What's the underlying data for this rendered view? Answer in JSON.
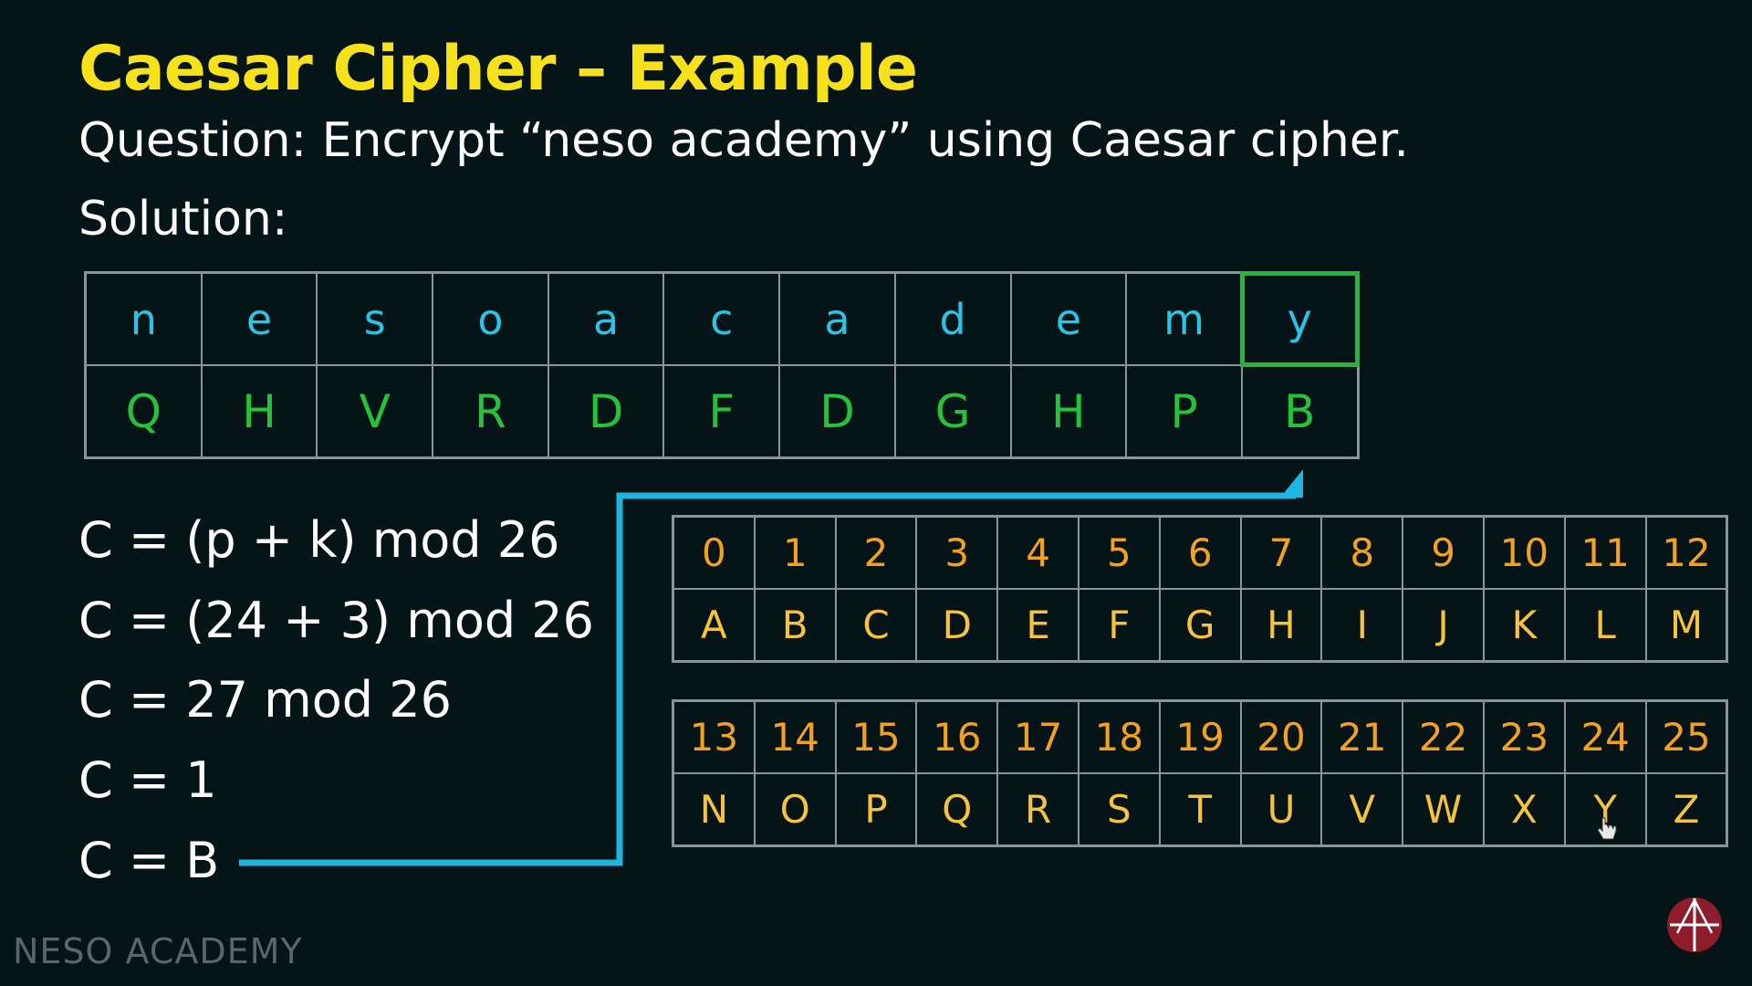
{
  "title": "Caesar Cipher – Example",
  "question": "Question: Encrypt “neso academy” using Caesar cipher.",
  "solution_label": "Solution:",
  "plaintext": [
    "n",
    "e",
    "s",
    "o",
    "a",
    "c",
    "a",
    "d",
    "e",
    "m",
    "y"
  ],
  "ciphertext": [
    "Q",
    "H",
    "V",
    "R",
    "D",
    "F",
    "D",
    "G",
    "H",
    "P",
    "B"
  ],
  "highlighted_index": 10,
  "formulas": [
    "C = (p + k) mod 26",
    "C = (24 + 3) mod 26",
    "C = 27 mod 26",
    "C = 1",
    "C = B"
  ],
  "alphabet_rows": [
    {
      "numbers": [
        "0",
        "1",
        "2",
        "3",
        "4",
        "5",
        "6",
        "7",
        "8",
        "9",
        "10",
        "11",
        "12"
      ],
      "letters": [
        "A",
        "B",
        "C",
        "D",
        "E",
        "F",
        "G",
        "H",
        "I",
        "J",
        "K",
        "L",
        "M"
      ]
    },
    {
      "numbers": [
        "13",
        "14",
        "15",
        "16",
        "17",
        "18",
        "19",
        "20",
        "21",
        "22",
        "23",
        "24",
        "25"
      ],
      "letters": [
        "N",
        "O",
        "P",
        "Q",
        "R",
        "S",
        "T",
        "U",
        "V",
        "W",
        "X",
        "Y",
        "Z"
      ]
    }
  ],
  "watermark": "NESO ACADEMY",
  "colors": {
    "background": "#051416",
    "title": "#f7e11a",
    "plain": "#29c4e6",
    "cipher": "#24c33a",
    "number": "#f4a21e",
    "letter": "#f6c33a",
    "connector": "#1fb5e0",
    "logo": "#8e1c2a"
  }
}
